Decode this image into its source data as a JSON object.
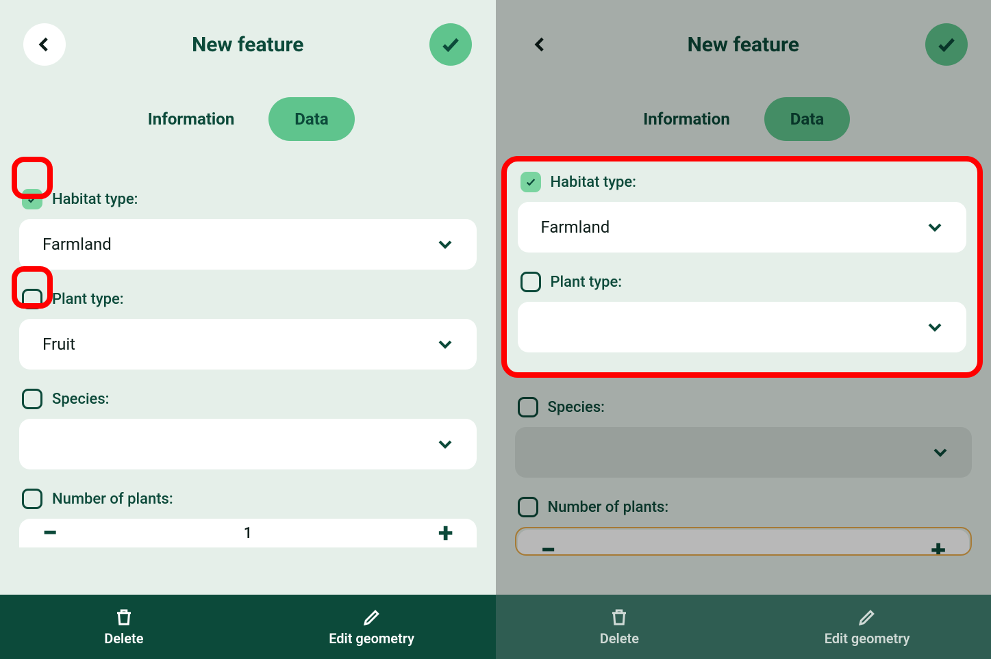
{
  "left": {
    "title": "New feature",
    "tabs": {
      "info": "Information",
      "data": "Data"
    },
    "fields": {
      "habitat": {
        "label": "Habitat type:",
        "value": "Farmland",
        "checked": true
      },
      "plant": {
        "label": "Plant type:",
        "value": "Fruit",
        "checked": false
      },
      "species": {
        "label": "Species:",
        "value": "",
        "checked": false
      },
      "count": {
        "label": "Number of plants:",
        "value": "1",
        "checked": false
      }
    },
    "bottom": {
      "delete": "Delete",
      "edit": "Edit geometry"
    }
  },
  "right": {
    "title": "New feature",
    "tabs": {
      "info": "Information",
      "data": "Data"
    },
    "fields": {
      "habitat": {
        "label": "Habitat type:",
        "value": "Farmland",
        "checked": true
      },
      "plant": {
        "label": "Plant type:",
        "value": "",
        "checked": false
      },
      "species": {
        "label": "Species:",
        "value": "",
        "checked": false
      },
      "count": {
        "label": "Number of plants:",
        "value": "",
        "checked": false
      }
    },
    "bottom": {
      "delete": "Delete",
      "edit": "Edit geometry"
    }
  },
  "colors": {
    "accent": "#5fc48d",
    "dark": "#0c4a3a",
    "highlight": "#ff0000"
  }
}
